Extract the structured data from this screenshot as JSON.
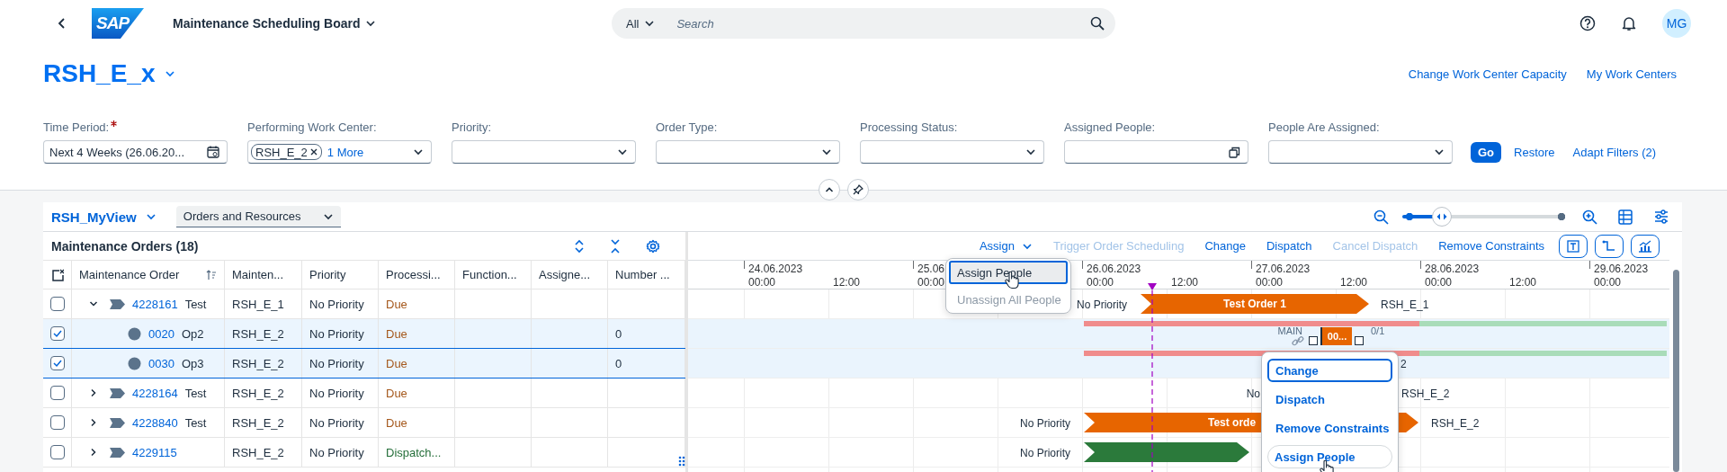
{
  "shell": {
    "logo": "SAP",
    "title": "Maintenance Scheduling Board",
    "search": {
      "scope": "All",
      "placeholder": "Search"
    },
    "avatar": "MG"
  },
  "page": {
    "title": "RSH_E_x",
    "links": [
      "Change Work Center Capacity",
      "My Work Centers"
    ]
  },
  "filters": [
    {
      "kind": "date",
      "label": "Time Period:",
      "required": true,
      "value": "Next 4 Weeks (26.06.20..."
    },
    {
      "kind": "tokens",
      "label": "Performing Work Center:",
      "required": false,
      "tokens": [
        "RSH_E_2"
      ],
      "more": "1 More"
    },
    {
      "kind": "select",
      "label": "Priority:",
      "required": false
    },
    {
      "kind": "select",
      "label": "Order Type:",
      "required": false
    },
    {
      "kind": "select",
      "label": "Processing Status:",
      "required": false
    },
    {
      "kind": "valuehelp",
      "label": "Assigned People:",
      "required": false
    },
    {
      "kind": "select",
      "label": "People Are Assigned:",
      "required": false
    }
  ],
  "filter_actions": {
    "go": "Go",
    "restore": "Restore",
    "adapt": "Adapt Filters (2)"
  },
  "view": {
    "name": "RSH_MyView",
    "mode": "Orders and Resources",
    "zoom": {
      "level": 0.24
    }
  },
  "table": {
    "title": "Maintenance Orders (18)",
    "columns": [
      "Maintenance Order",
      "Mainten...",
      "Priority",
      "Processi...",
      "Function...",
      "Assigne...",
      "Number ..."
    ],
    "rows": [
      {
        "kind": "order",
        "id": "4228161",
        "text": "Test",
        "expanded": true,
        "selected": false,
        "work_center": "RSH_E_1",
        "priority": "No Priority",
        "status": "Due",
        "color": "#a5581c",
        "children": [
          {
            "kind": "operation",
            "id": "0020",
            "text": "Op2",
            "selected": true,
            "work_center": "RSH_E_2",
            "priority": "No Priority",
            "status": "Due",
            "color": "#a5581c",
            "number": "0"
          },
          {
            "kind": "operation",
            "id": "0030",
            "text": "Op3",
            "selected": true,
            "work_center": "RSH_E_2",
            "priority": "No Priority",
            "status": "Due",
            "color": "#a5581c",
            "number": "0"
          }
        ]
      },
      {
        "kind": "order",
        "id": "4228164",
        "text": "Test",
        "expanded": false,
        "selected": false,
        "work_center": "RSH_E_2",
        "priority": "No Priority",
        "status": "Due",
        "color": "#a5581c"
      },
      {
        "kind": "order",
        "id": "4228840",
        "text": "Test",
        "expanded": false,
        "selected": false,
        "work_center": "RSH_E_2",
        "priority": "No Priority",
        "status": "Due",
        "color": "#a5581c"
      },
      {
        "kind": "order",
        "id": "4229115",
        "expanded": false,
        "selected": false,
        "work_center": "RSH_E_2",
        "priority": "No Priority",
        "status": "Dispatch...",
        "color": "#256f3a"
      }
    ]
  },
  "gantt": {
    "toolbar": [
      {
        "kind": "menu",
        "label": "Assign",
        "disabled": false
      },
      {
        "kind": "action",
        "label": "Trigger Order Scheduling",
        "disabled": true
      },
      {
        "kind": "action",
        "label": "Change",
        "disabled": false
      },
      {
        "kind": "action",
        "label": "Dispatch",
        "disabled": false
      },
      {
        "kind": "action",
        "label": "Cancel Dispatch",
        "disabled": true
      },
      {
        "kind": "action",
        "label": "Remove Constraints",
        "disabled": false
      }
    ],
    "days": [
      {
        "date": "24.06.2023",
        "times": [
          "00:00",
          "12:00"
        ]
      },
      {
        "date": "25.06",
        "times": [
          "00:00"
        ]
      },
      {
        "date": "26.06.2023",
        "times": [
          "00:00",
          "12:00"
        ]
      },
      {
        "date": "27.06.2023",
        "times": [
          "00:00",
          "12:00"
        ]
      },
      {
        "date": "28.06.2023",
        "times": [
          "00:00",
          "12:00"
        ]
      },
      {
        "date": "29.06.2023",
        "times": [
          "00:00"
        ]
      }
    ],
    "rows": [
      {
        "kind": "order",
        "selected": false,
        "left_label": "No Priority",
        "bar": {
          "label": "Test Order 1",
          "color": "#e76500"
        },
        "right_label": "RSH_E_1"
      },
      {
        "kind": "operation",
        "selected": true,
        "left_label": "MAIN",
        "bar": {
          "label": "00...",
          "color": "#e76500"
        },
        "right_label": "0/1"
      },
      {
        "kind": "operation",
        "selected": true,
        "right_label": "2"
      },
      {
        "kind": "order",
        "selected": false,
        "left_label": "No",
        "right_label": "RSH_E_2"
      },
      {
        "kind": "order",
        "selected": false,
        "left_label": "No Priority",
        "bar": {
          "label": "Test orde",
          "color": "#e76500"
        },
        "right_label": "RSH_E_2"
      },
      {
        "kind": "order",
        "selected": false,
        "left_label": "No Priority",
        "bar": {
          "color": "#2b7a3b"
        }
      }
    ],
    "assign_menu": [
      {
        "label": "Assign People",
        "focused": true,
        "disabled": false
      },
      {
        "label": "Unassign All People",
        "focused": false,
        "disabled": true
      }
    ],
    "context_menu": [
      {
        "label": "Change",
        "focused": true,
        "hovered": false
      },
      {
        "label": "Dispatch",
        "focused": false,
        "hovered": false
      },
      {
        "label": "Remove Constraints",
        "focused": false,
        "hovered": false
      },
      {
        "label": "Assign People",
        "focused": false,
        "hovered": true
      }
    ]
  }
}
